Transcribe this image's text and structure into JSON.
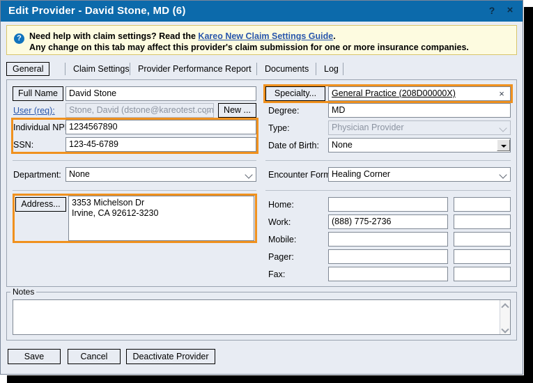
{
  "window": {
    "title": "Edit Provider - David Stone, MD (6)",
    "help_btn": "?",
    "close_btn": "×"
  },
  "notice": {
    "icon": "?",
    "line1_before": "Need help with claim settings? Read the ",
    "line1_link": "Kareo New Claim Settings Guide",
    "line1_after": ".",
    "line2": "Any change on this tab may affect this provider's claim submission for one or more insurance companies."
  },
  "tabs": [
    {
      "label": "General",
      "active": true
    },
    {
      "label": "Claim Settings",
      "active": false
    },
    {
      "label": "Provider Performance Report",
      "active": false
    },
    {
      "label": "Documents",
      "active": false
    },
    {
      "label": "Log",
      "active": false
    }
  ],
  "form": {
    "full_name": {
      "button": "Full Name",
      "value": "David Stone"
    },
    "user": {
      "label": "User (req):",
      "value": "Stone, David (dstone@kareotest.com)",
      "new_button": "New ..."
    },
    "npi": {
      "label": "Individual NPI:",
      "value": "1234567890"
    },
    "ssn": {
      "label": "SSN:",
      "value": "123-45-6789"
    },
    "department": {
      "label": "Department:",
      "value": "None"
    },
    "address": {
      "button": "Address...",
      "line1": "3353 Michelson Dr",
      "line2": "Irvine, CA 92612-3230"
    },
    "specialty": {
      "button": "Specialty...",
      "value": "General Practice (208D00000X)",
      "clear": "×"
    },
    "degree": {
      "label": "Degree:",
      "value": "MD"
    },
    "type": {
      "label": "Type:",
      "value": "Physician Provider"
    },
    "dob": {
      "label": "Date of Birth:",
      "value": "None"
    },
    "encounter_form": {
      "label": "Encounter Form:",
      "value": "Healing Corner"
    },
    "phones": [
      {
        "label": "Home:",
        "value": "",
        "ext": ""
      },
      {
        "label": "Work:",
        "value": "(888) 775-2736",
        "ext": ""
      },
      {
        "label": "Mobile:",
        "value": "",
        "ext": ""
      },
      {
        "label": "Pager:",
        "value": "",
        "ext": ""
      },
      {
        "label": "Fax:",
        "value": "",
        "ext": ""
      }
    ]
  },
  "notes": {
    "legend": "Notes",
    "value": ""
  },
  "footer": {
    "save": "Save",
    "cancel": "Cancel",
    "deactivate": "Deactivate Provider"
  },
  "colors": {
    "titlebar": "#0c6aab",
    "highlight": "#f0911e",
    "notice_bg": "#fdfbe0",
    "link": "#2a57ac",
    "panel_bg": "#e8ecf3"
  }
}
